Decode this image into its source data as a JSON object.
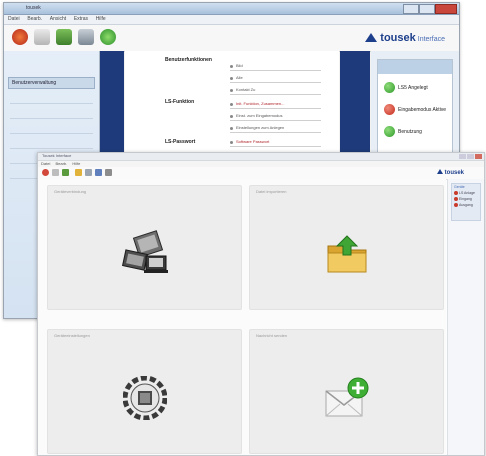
{
  "back_window": {
    "menu": [
      "Datei",
      "Bearb.",
      "Ansicht",
      "Extras",
      "Hilfe"
    ],
    "brand": {
      "name": "tousek",
      "sub": "Interface"
    },
    "center": {
      "groups": [
        "Benutzerfunktionen",
        "LS-Funktion",
        "LS-Passwort"
      ],
      "lines": [
        "Bild",
        "Alle",
        "Kontakt Zu",
        "Init. Funktion, Zusammen...",
        "Einst. zum Eingabemodus",
        "Einstellungen zum Anlegen",
        "Software Passwort"
      ]
    },
    "left_nav": "Benutzerverwaltung",
    "status": [
      {
        "label": "LS5 Angelegt",
        "color": "#2f9a2a"
      },
      {
        "label": "Eingabemodus Aktive",
        "color": "#c22b1b"
      },
      {
        "label": "Benutzung",
        "color": "#2f9a2a"
      }
    ]
  },
  "front_window": {
    "title": "Tousek Interface",
    "menu": [
      "Datei",
      "Bearb.",
      "Hilfe"
    ],
    "brand": {
      "name": "tousek"
    },
    "tiles": [
      {
        "label": "Geräteverbindung",
        "icon": "network-computers-icon"
      },
      {
        "label": "Datei importieren",
        "icon": "folder-upload-icon"
      },
      {
        "label": "Geräteeinstellungen",
        "icon": "device-dial-icon"
      },
      {
        "label": "Nachricht senden",
        "icon": "mail-add-icon"
      }
    ],
    "side": {
      "title": "Geräte",
      "items": [
        "LS Anlage",
        "Eingang",
        "Ausgang"
      ],
      "accent": "#c83a2b"
    }
  }
}
